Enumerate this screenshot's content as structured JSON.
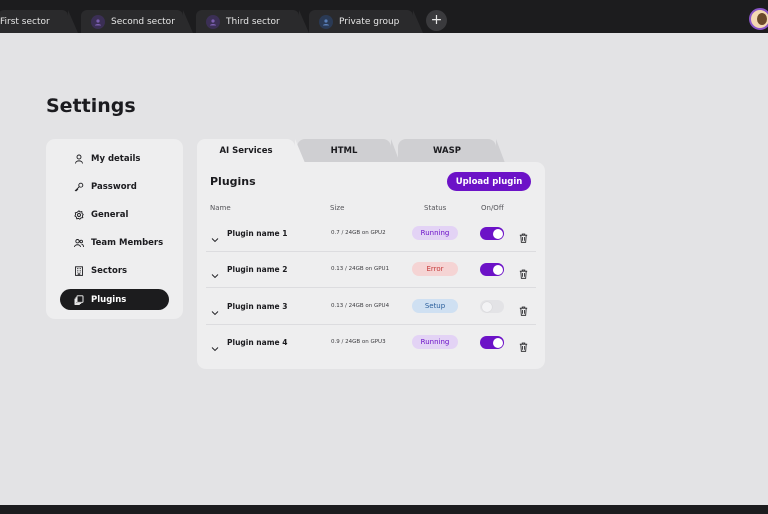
{
  "top_tabs": [
    {
      "label": "First sector"
    },
    {
      "label": "Second sector"
    },
    {
      "label": "Third sector"
    },
    {
      "label": "Private group"
    }
  ],
  "add_tab_label": "+",
  "page_title": "Settings",
  "sidebar": {
    "items": [
      {
        "label": "My details",
        "icon": "user-icon"
      },
      {
        "label": "Password",
        "icon": "key-icon"
      },
      {
        "label": "General",
        "icon": "gear-icon"
      },
      {
        "label": "Team Members",
        "icon": "users-icon"
      },
      {
        "label": "Sectors",
        "icon": "building-icon"
      },
      {
        "label": "Plugins",
        "icon": "plugins-icon",
        "active": true
      }
    ]
  },
  "content_tabs": [
    {
      "label": "AI Services",
      "active": true
    },
    {
      "label": "HTML"
    },
    {
      "label": "WASP"
    }
  ],
  "panel": {
    "title": "Plugins",
    "upload_label": "Upload plugin",
    "columns": {
      "name": "Name",
      "size": "Size",
      "status": "Status",
      "onoff": "On/Off"
    },
    "rows": [
      {
        "name": "Plugin name 1",
        "size": "0.7 / 24GB on GPU2",
        "status": "Running",
        "enabled": true
      },
      {
        "name": "Plugin name 2",
        "size": "0.13 / 24GB on GPU1",
        "status": "Error",
        "enabled": true
      },
      {
        "name": "Plugin name 3",
        "size": "0.13 / 24GB on GPU4",
        "status": "Setup",
        "enabled": false
      },
      {
        "name": "Plugin name 4",
        "size": "0.9 / 24GB on GPU3",
        "status": "Running",
        "enabled": true
      }
    ]
  },
  "colors": {
    "accent": "#6c12c7",
    "running_bg": "#e3d3f5",
    "error_bg": "#f5d4d4",
    "setup_bg": "#cfe0f2"
  }
}
